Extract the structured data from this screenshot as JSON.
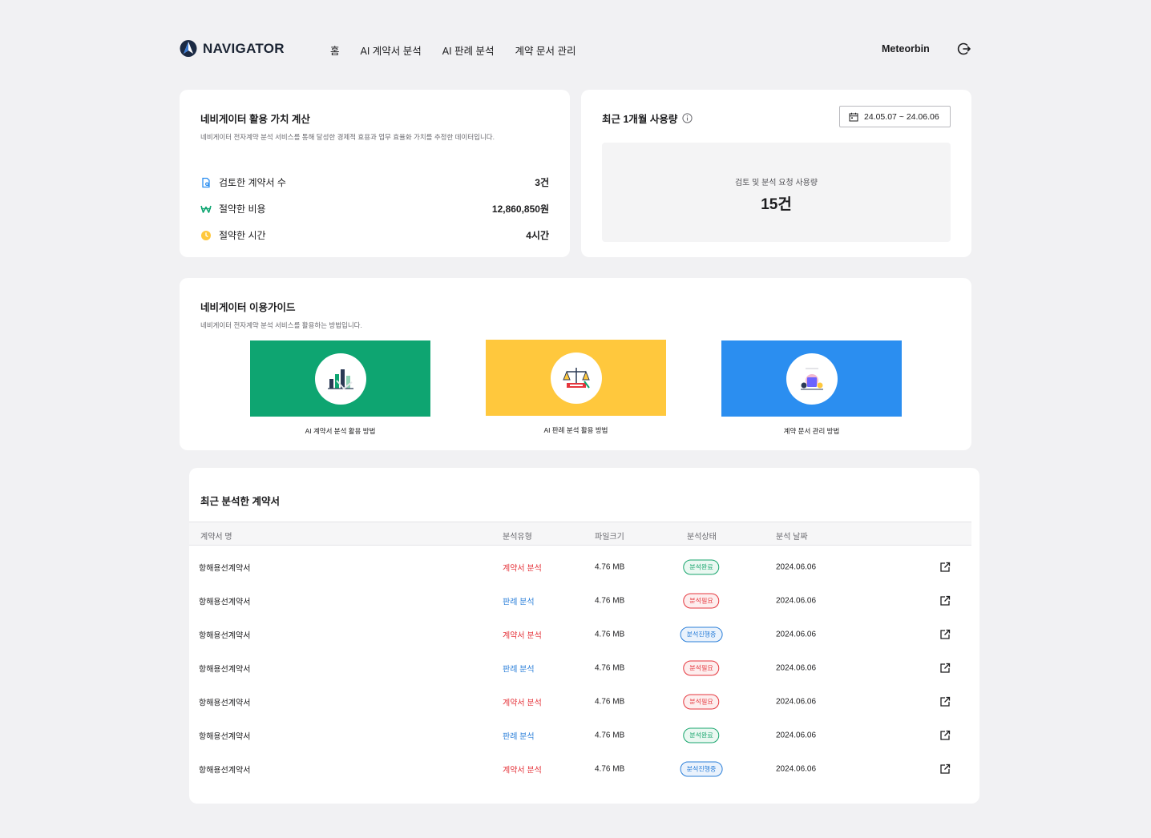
{
  "brand": {
    "name": "NAVIGATOR"
  },
  "nav": {
    "items": [
      "홈",
      "AI 계약서 분석",
      "AI 판례 분석",
      "계약 문서 관리"
    ]
  },
  "user": {
    "name": "Meteorbin"
  },
  "value_card": {
    "title": "네비게이터 활용 가치 계산",
    "subtitle": "네비게이터 전자계약 분석 서비스를 통해 달성한 경제적 효용과 업무 효율화 가치를 추정한 데이터입니다.",
    "stats": [
      {
        "label": "검토한 계약서 수",
        "value": "3건",
        "icon": "document-search-icon"
      },
      {
        "label": "절약한 비용",
        "value": "12,860,850원",
        "icon": "won-icon"
      },
      {
        "label": "절약한 시간",
        "value": "4시간",
        "icon": "clock-icon"
      }
    ]
  },
  "usage_card": {
    "title": "최근 1개월 사용량",
    "date_range": "24.05.07 ~ 24.06.06",
    "label": "검토 및 분석 요청 사용량",
    "value": "15건"
  },
  "guide_card": {
    "title": "네비게이터 이용가이드",
    "subtitle": "네비게이터 전자계약 분석 서비스를 활용하는 방법입니다.",
    "items": [
      {
        "label": "AI 계약서 분석 활용 방법",
        "color": "#0ea571"
      },
      {
        "label": "AI 판례 분석 활용 방법",
        "color": "#ffc83d"
      },
      {
        "label": "계약 문서 관리 방법",
        "color": "#2b8ef0"
      }
    ]
  },
  "table": {
    "title": "최근 분석한 계약서",
    "headers": [
      "계약서 명",
      "분석유형",
      "파일크기",
      "분석상태",
      "분석 날짜"
    ],
    "rows": [
      {
        "name": "항해용선계약서",
        "type": "계약서 분석",
        "size": "4.76 MB",
        "status": "분석완료",
        "date": "2024.06.06"
      },
      {
        "name": "항해용선계약서",
        "type": "판례 분석",
        "size": "4.76 MB",
        "status": "분석필요",
        "date": "2024.06.06"
      },
      {
        "name": "항해용선계약서",
        "type": "계약서 분석",
        "size": "4.76 MB",
        "status": "분석진행중",
        "date": "2024.06.06"
      },
      {
        "name": "항해용선계약서",
        "type": "판례 분석",
        "size": "4.76 MB",
        "status": "분석필요",
        "date": "2024.06.06"
      },
      {
        "name": "항해용선계약서",
        "type": "계약서 분석",
        "size": "4.76 MB",
        "status": "분석필요",
        "date": "2024.06.06"
      },
      {
        "name": "항해용선계약서",
        "type": "판례 분석",
        "size": "4.76 MB",
        "status": "분석완료",
        "date": "2024.06.06"
      },
      {
        "name": "항해용선계약서",
        "type": "계약서 분석",
        "size": "4.76 MB",
        "status": "분석진행중",
        "date": "2024.06.06"
      }
    ]
  }
}
